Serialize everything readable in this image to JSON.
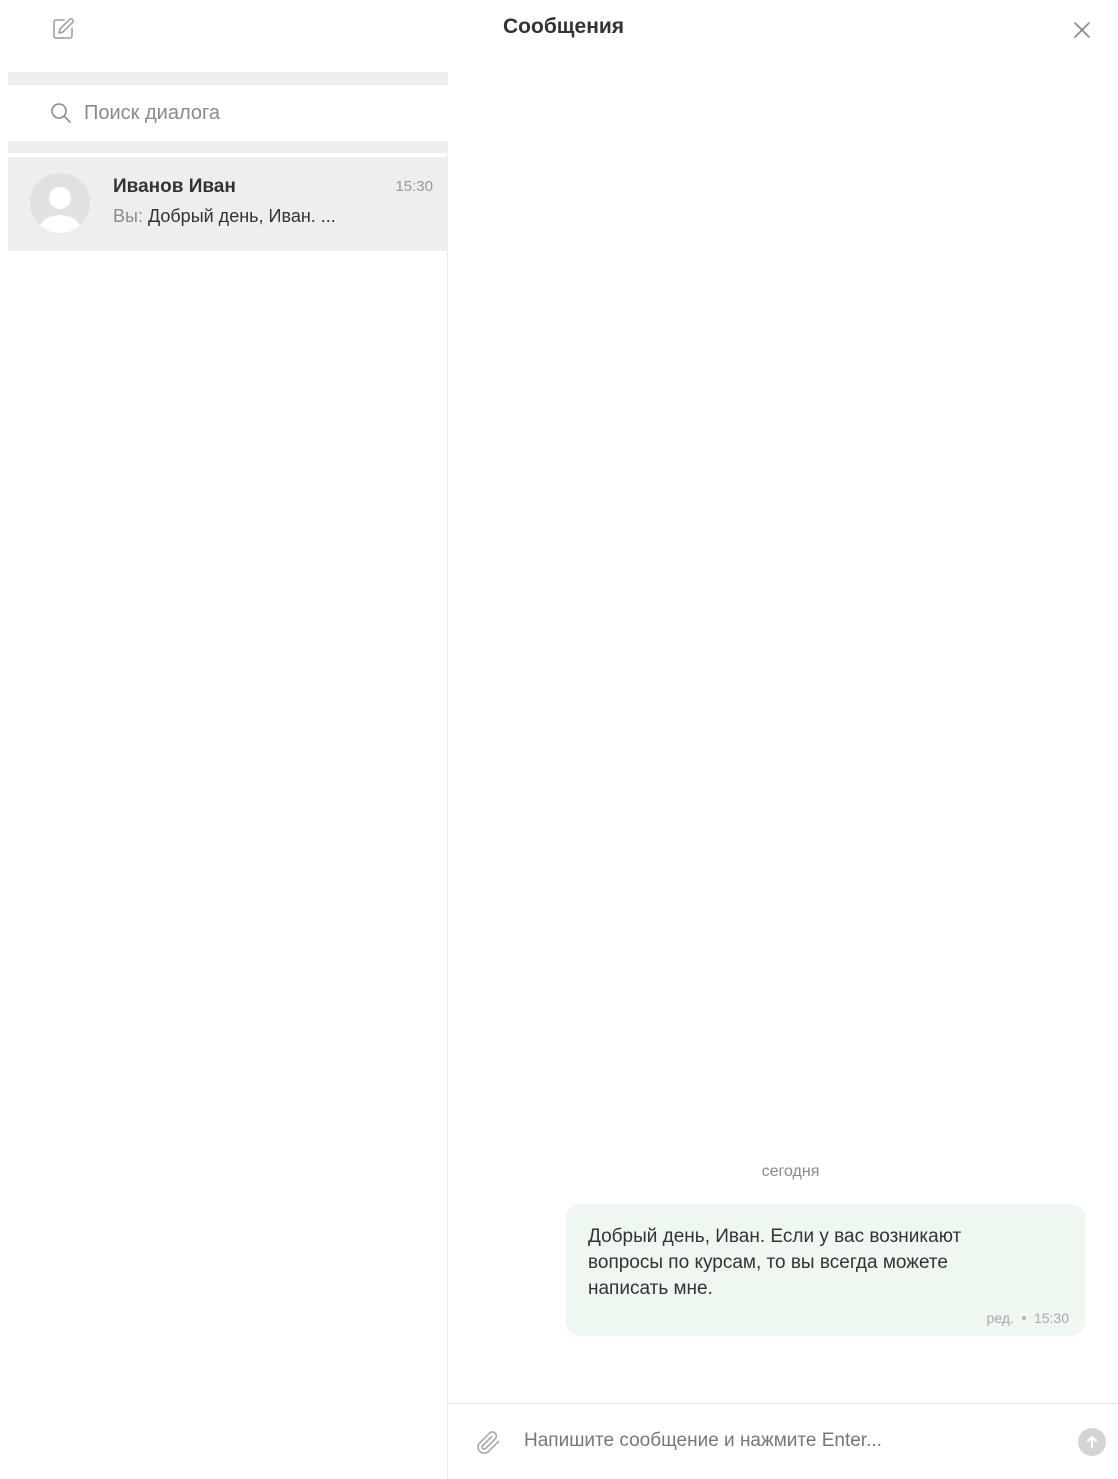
{
  "header": {
    "title": "Сообщения",
    "compose_icon": "edit-icon",
    "close_icon": "close-icon"
  },
  "sidebar": {
    "search": {
      "placeholder": "Поиск диалога",
      "icon": "search-icon"
    },
    "dialogs": [
      {
        "name": "Иванов Иван",
        "time": "15:30",
        "preview_prefix": "Вы:",
        "preview_text": "Добрый день, Иван. ...",
        "avatar_icon": "user-avatar-icon",
        "selected": true
      }
    ]
  },
  "chat": {
    "date_separator": "сегодня",
    "messages": [
      {
        "text": "Добрый день, Иван. Если у вас возникают вопросы по курсам, то вы всегда можете написать мне.",
        "edited_label": "ред.",
        "time": "15:30",
        "outgoing": true
      }
    ]
  },
  "composer": {
    "placeholder": "Напишите сообщение и нажмите Enter...",
    "attach_icon": "paperclip-icon",
    "send_icon": "send-arrow-icon"
  },
  "colors": {
    "sidebar_bg": "#eeeeee",
    "bubble_bg": "#eff7f1",
    "muted_text": "#8a8a8a",
    "send_button": "#d4d4d4"
  }
}
